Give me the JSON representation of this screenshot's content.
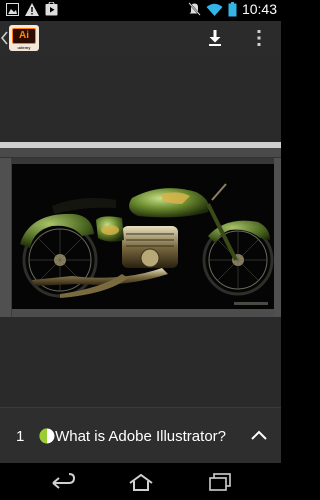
{
  "status_bar": {
    "time": "10:43",
    "icons": [
      "image-notification-icon",
      "warning-icon",
      "play-store-icon",
      "mute-icon",
      "wifi-icon",
      "battery-icon"
    ]
  },
  "app_bar": {
    "logo": {
      "main": "Ai",
      "sub": "udemy"
    },
    "actions": [
      "download-icon",
      "more-vert-icon"
    ]
  },
  "lesson": {
    "number": "1",
    "title": "What is Adobe Illustrator?",
    "progress": 0.5
  },
  "colors": {
    "app_bar": "#2b2b2b",
    "background": "#2a2a2a",
    "progress_accent": "#9acd32",
    "logo_orange": "#ff7c00"
  },
  "nav_bar": {
    "buttons": [
      "back-icon",
      "home-icon",
      "recent-apps-icon"
    ]
  }
}
